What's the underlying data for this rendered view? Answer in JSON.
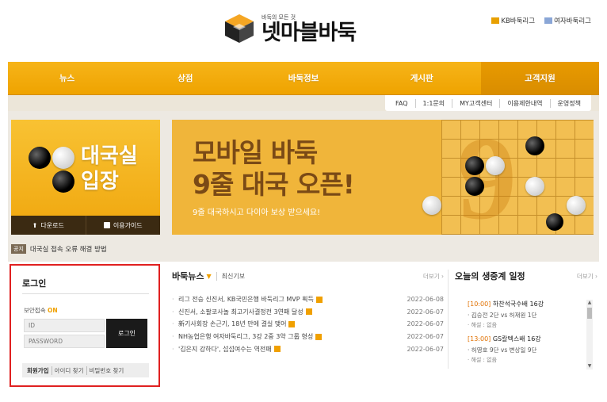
{
  "header": {
    "logo_sub": "바둑의 모든 것",
    "logo_main": "넷마블바둑",
    "top_links": [
      "KB바둑리그",
      "여자바둑리그"
    ]
  },
  "nav": {
    "items": [
      "뉴스",
      "상점",
      "바둑정보",
      "게시판",
      "고객지원"
    ],
    "active": "고객지원",
    "sub_items": [
      "FAQ",
      "1:1문의",
      "MY고객센터",
      "이용제한내역",
      "운영정책"
    ]
  },
  "game_room": {
    "title_line1": "대국실",
    "title_line2": "입장",
    "download_label": "다운로드",
    "guide_label": "이용가이드"
  },
  "notice": {
    "tag": "공지",
    "text": "대국실 접속 오류 해결 방법"
  },
  "banner": {
    "line1": "모바일 바둑",
    "line2": "9줄 대국 오픈!",
    "subtitle": "9줄 대국하시고 다이아 보상 받으세요!",
    "number": "9"
  },
  "login": {
    "title": "로그인",
    "secure_label": "보안접속",
    "secure_state": "ON",
    "id_placeholder": "ID",
    "password_placeholder": "PASSWORD",
    "login_button": "로그인",
    "links": [
      "회원가입",
      "아이디 찾기",
      "비밀번호 찾기"
    ]
  },
  "news": {
    "title": "바둑뉴스",
    "subtitle": "최신기보",
    "more": "더보기",
    "items": [
      {
        "title": "리그 전승 신진서, KB국민은행 바둑리그 MVP 획득",
        "date": "2022-06-08"
      },
      {
        "title": "신진서, 소팔코사놀 최고기사결정전 3연패 달성",
        "date": "2022-06-07"
      },
      {
        "title": "新기사회장 손근기, 18년 만에 결실 맺어",
        "date": "2022-06-07"
      },
      {
        "title": "NH농협은행 여자바둑리그, 3강 2중 3약 그룹 형성",
        "date": "2022-06-07"
      },
      {
        "title": "'김은지 강하다', 섭섭여수는 역전패",
        "date": "2022-06-07"
      }
    ]
  },
  "schedule": {
    "title": "오늘의 생중계 일정",
    "more": "더보기",
    "items": [
      {
        "time": "[10:00]",
        "event": "하찬석국수배 16강",
        "players": "김승전 2단 vs 허재원 1단",
        "commentary": "해설 : 없음"
      },
      {
        "time": "[13:00]",
        "event": "GS칼텍스배 16강",
        "players": "허영호 9단 vs 변상일 9단",
        "commentary": "해설 : 없음"
      }
    ]
  },
  "colors": {
    "accent": "#f0a600",
    "login_border": "#e02020",
    "dark": "#1a1a1a"
  }
}
